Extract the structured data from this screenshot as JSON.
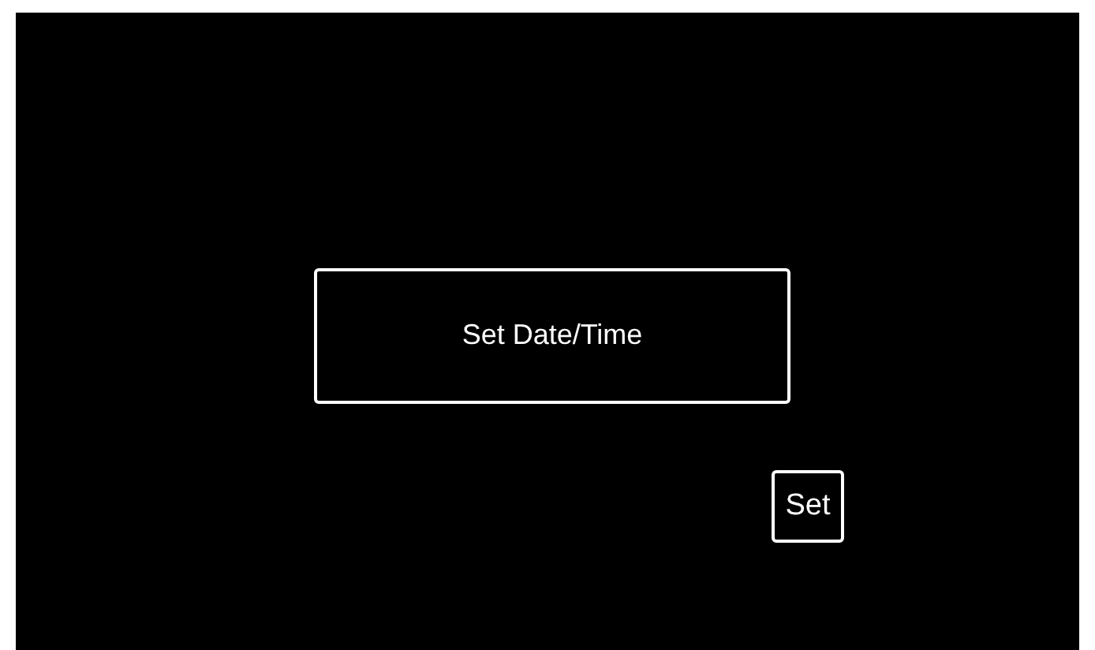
{
  "main_button": {
    "label": "Set Date/Time"
  },
  "set_button": {
    "label": "Set"
  }
}
